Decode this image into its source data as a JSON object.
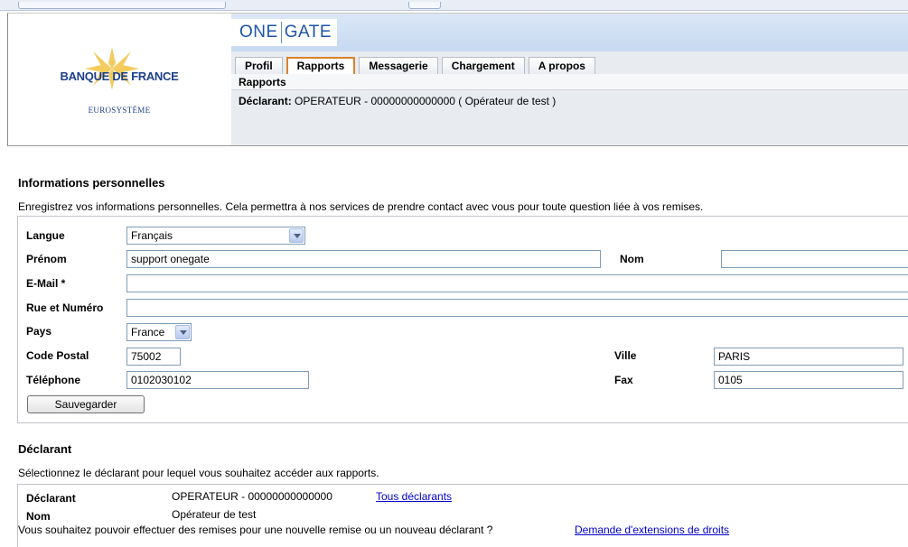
{
  "header": {
    "logo_name": "BANQUE DE FRANCE",
    "logo_sub": "EUROSYSTÈME",
    "brand_left": "ONE",
    "brand_right": "GATE",
    "tabs": [
      {
        "label": "Profil"
      },
      {
        "label": "Rapports"
      },
      {
        "label": "Messagerie"
      },
      {
        "label": "Chargement"
      },
      {
        "label": "A propos"
      }
    ],
    "active_tab": "Rapports",
    "subnav": "Rapports",
    "declarant_label": "Déclarant:",
    "declarant_value": "OPERATEUR - 00000000000000 ( Opérateur de test )"
  },
  "personal": {
    "title": "Informations personnelles",
    "description": "Enregistrez vos informations personnelles. Cela permettra à nos services de prendre contact avec vous pour toute question liée à vos remises.",
    "langue_label": "Langue",
    "langue_value": "Français",
    "prenom_label": "Prénom",
    "prenom_value": "support onegate",
    "nom_label": "Nom",
    "nom_value": "",
    "email_label": "E-Mail *",
    "email_value": "",
    "rue_label": "Rue et Numéro",
    "rue_value": "",
    "pays_label": "Pays",
    "pays_value": "France",
    "cp_label": "Code Postal",
    "cp_value": "75002",
    "ville_label": "Ville",
    "ville_value": "PARIS",
    "tel_label": "Téléphone",
    "tel_value": "0102030102",
    "fax_label": "Fax",
    "fax_value": "0105",
    "save_label": "Sauvegarder"
  },
  "declarant": {
    "title": "Déclarant",
    "description": "Sélectionnez le déclarant pour lequel vous souhaitez accéder aux rapports.",
    "declarant_label": "Déclarant",
    "declarant_value": "OPERATEUR - 00000000000000",
    "all_link": "Tous déclarants",
    "nom_label": "Nom",
    "nom_value": "Opérateur de test",
    "extension_question": "Vous souhaitez pouvoir effectuer des remises pour une nouvelle remise ou un nouveau déclarant ?",
    "extension_link": "Demande d'extensions de droits"
  },
  "colors": {
    "brand_blue": "#1e55a8",
    "active_tab_border": "#d9822b",
    "link": "#0000cc"
  }
}
